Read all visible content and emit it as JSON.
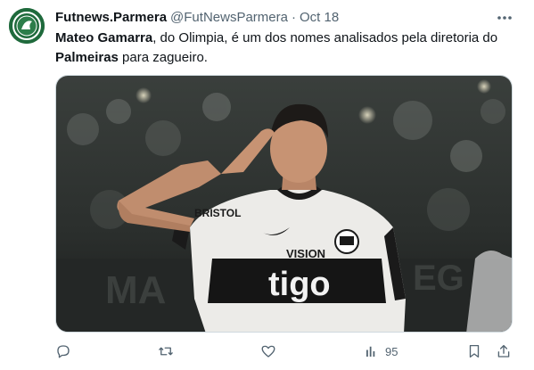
{
  "tweet": {
    "author": {
      "display_name": "Futnews.Parmera",
      "handle": "@FutNewsParmera",
      "separator": "·",
      "date": "Oct 18"
    },
    "text": {
      "p1_bold": "Mateo Gamarra",
      "p1_rest": ", do Olimpia, é um dos nomes analisados pela diretoria do",
      "p2_bold": "Palmeiras",
      "p2_rest": " para zagueiro."
    },
    "media": {
      "jersey_sponsor": "BRISTOL",
      "jersey_brand": "VISION",
      "jersey_main": "tigo",
      "banner_text": "MA",
      "banner_text_right": "EG"
    },
    "actions": {
      "reply_icon": "reply-icon",
      "retweet_icon": "retweet-icon",
      "like_icon": "heart-icon",
      "views_icon": "views-bar-icon",
      "views_count": "95",
      "bookmark_icon": "bookmark-icon",
      "share_icon": "share-icon"
    }
  },
  "colors": {
    "text_primary": "#0f1419",
    "text_secondary": "#536471",
    "avatar_green": "#1f6a3c",
    "border": "#cfd9de"
  }
}
